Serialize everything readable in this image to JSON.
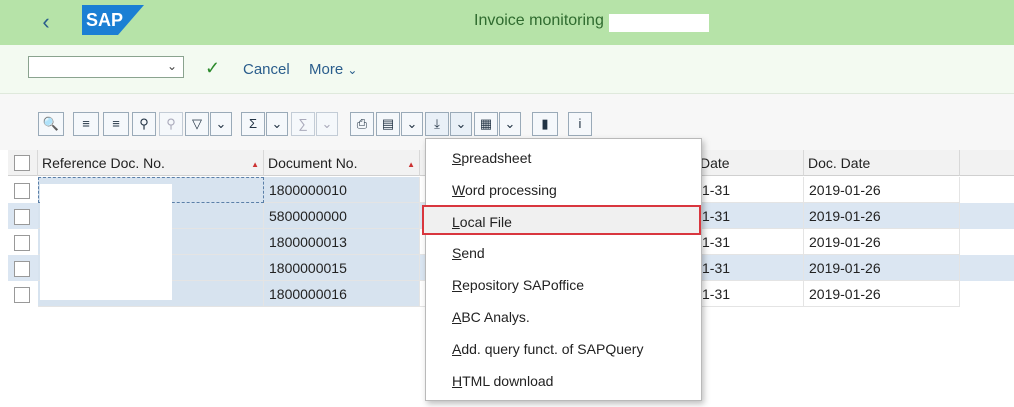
{
  "header": {
    "back_icon": "chevron-left-icon",
    "logo_text": "SAP",
    "title": "Invoice monitoring",
    "bg_color": "#b6e3a8"
  },
  "toolbar": {
    "variant_value": "",
    "check_icon": "checkmark-icon",
    "cancel_label": "Cancel",
    "more_label": "More"
  },
  "grid": {
    "columns": [
      "Reference Doc. No.",
      "Document No.",
      "Date",
      "Doc. Date"
    ],
    "rows": [
      {
        "ref": "",
        "doc_no": "1800000010",
        "date": "1-31",
        "doc_date": "2019-01-26"
      },
      {
        "ref": "",
        "doc_no": "5800000000",
        "date": "1-31",
        "doc_date": "2019-01-26"
      },
      {
        "ref": "",
        "doc_no": "1800000013",
        "date": "1-31",
        "doc_date": "2019-01-26"
      },
      {
        "ref": "",
        "doc_no": "1800000015",
        "date": "1-31",
        "doc_date": "2019-01-26"
      },
      {
        "ref": "",
        "doc_no": "1800000016",
        "date": "1-31",
        "doc_date": "2019-01-26"
      }
    ]
  },
  "export_menu": {
    "items": [
      {
        "pre": "",
        "u": "S",
        "post": "preadsheet"
      },
      {
        "pre": "",
        "u": "W",
        "post": "ord processing"
      },
      {
        "pre": "",
        "u": "L",
        "post": "ocal File"
      },
      {
        "pre": "",
        "u": "S",
        "post": "end"
      },
      {
        "pre": "",
        "u": "R",
        "post": "epository SAPoffice"
      },
      {
        "pre": "",
        "u": "A",
        "post": "BC Analys."
      },
      {
        "pre": "",
        "u": "A",
        "post": "dd. query funct. of SAPQuery"
      },
      {
        "pre": "",
        "u": "H",
        "post": "TML download"
      }
    ],
    "highlighted_index": 2,
    "highlight_color": "#d9363e"
  }
}
